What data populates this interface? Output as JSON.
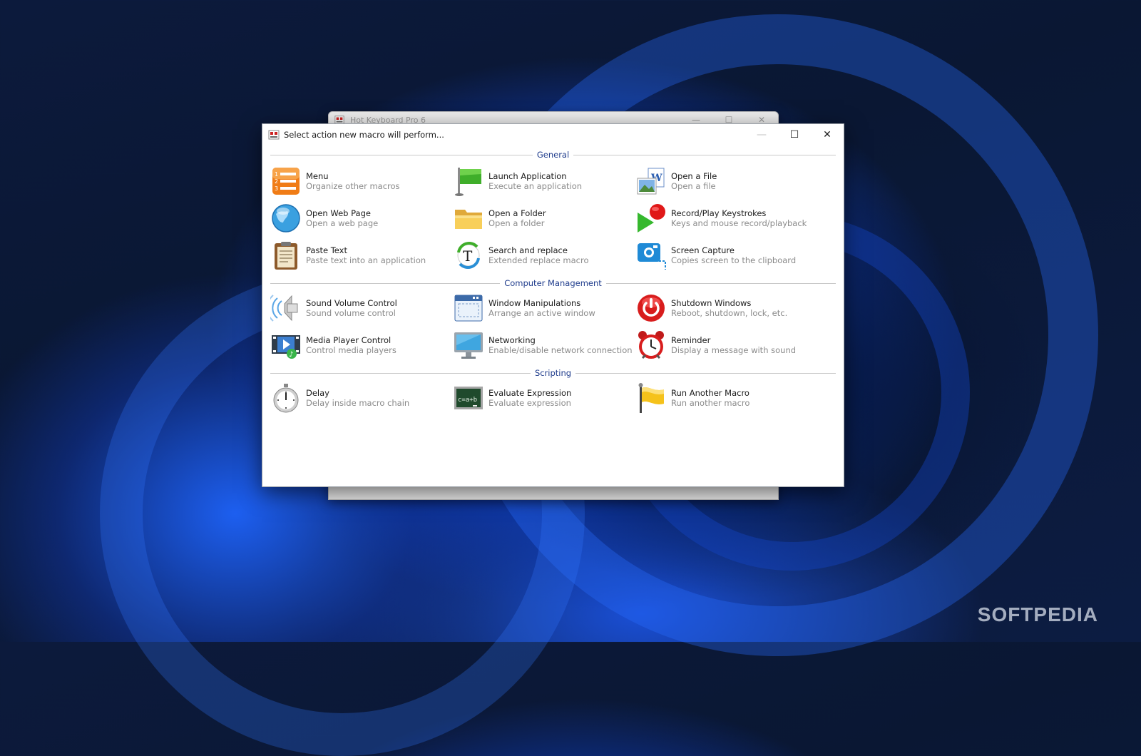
{
  "background_window": {
    "title": "Hot Keyboard Pro 6",
    "controls": {
      "minimize": "—",
      "maximize": "☐",
      "close": "✕"
    }
  },
  "dialog": {
    "title": "Select action new macro will perform...",
    "controls": {
      "minimize": "—",
      "maximize": "☐",
      "close": "✕"
    }
  },
  "sections": {
    "general": {
      "label": "General",
      "items": [
        {
          "name": "Menu",
          "desc": "Organize other macros",
          "icon": "menu-list-icon"
        },
        {
          "name": "Launch Application",
          "desc": "Execute an application",
          "icon": "green-flag-icon"
        },
        {
          "name": "Open a File",
          "desc": "Open a file",
          "icon": "file-icon"
        },
        {
          "name": "Open Web Page",
          "desc": "Open a web page",
          "icon": "globe-icon"
        },
        {
          "name": "Open a Folder",
          "desc": "Open a folder",
          "icon": "folder-icon"
        },
        {
          "name": "Record/Play Keystrokes",
          "desc": "Keys and mouse record/playback",
          "icon": "record-play-icon"
        },
        {
          "name": "Paste Text",
          "desc": "Paste text into an application",
          "icon": "clipboard-icon"
        },
        {
          "name": "Search and replace",
          "desc": "Extended replace macro",
          "icon": "search-replace-icon"
        },
        {
          "name": "Screen Capture",
          "desc": "Copies screen to the clipboard",
          "icon": "camera-icon"
        }
      ]
    },
    "computer_management": {
      "label": "Computer Management",
      "items": [
        {
          "name": "Sound Volume Control",
          "desc": "Sound volume control",
          "icon": "speaker-icon"
        },
        {
          "name": "Window Manipulations",
          "desc": "Arrange an active window",
          "icon": "window-icon"
        },
        {
          "name": "Shutdown Windows",
          "desc": "Reboot, shutdown, lock, etc.",
          "icon": "power-icon"
        },
        {
          "name": "Media Player Control",
          "desc": "Control media players",
          "icon": "media-player-icon"
        },
        {
          "name": "Networking",
          "desc": "Enable/disable network connection",
          "icon": "monitor-icon"
        },
        {
          "name": "Reminder",
          "desc": "Display a message with sound",
          "icon": "alarm-clock-icon"
        }
      ]
    },
    "scripting": {
      "label": "Scripting",
      "items": [
        {
          "name": "Delay",
          "desc": "Delay inside macro chain",
          "icon": "stopwatch-icon"
        },
        {
          "name": "Evaluate Expression",
          "desc": "Evaluate expression",
          "icon": "chalkboard-icon"
        },
        {
          "name": "Run Another Macro",
          "desc": "Run another macro",
          "icon": "yellow-flag-icon"
        }
      ]
    }
  },
  "watermark": "SOFTPEDIA",
  "colors": {
    "section_label": "#1f3c8c",
    "description": "#8a8a8a",
    "wallpaper_blue": "#1e5fe8"
  }
}
